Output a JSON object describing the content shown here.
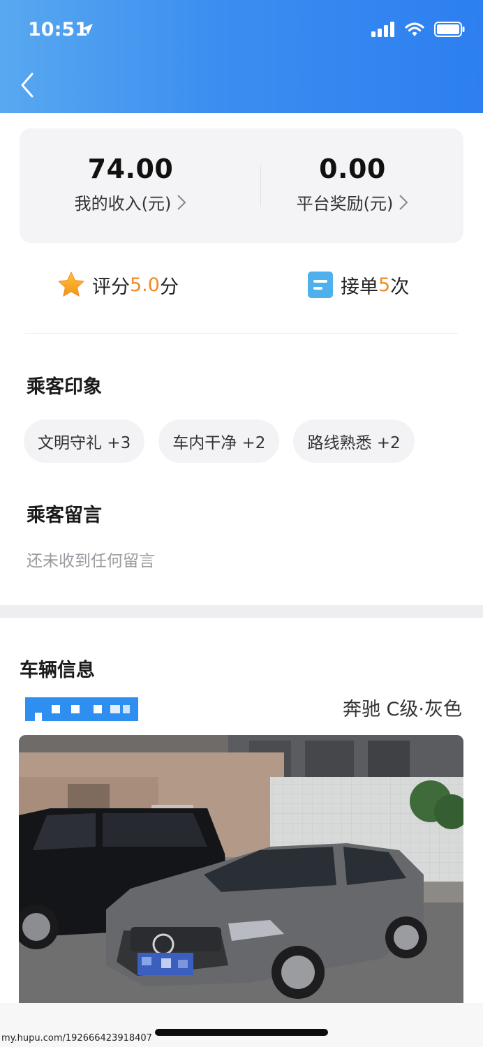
{
  "status_bar": {
    "time": "10:51"
  },
  "stats": {
    "income_value": "74.00",
    "income_label": "我的收入(元)",
    "reward_value": "0.00",
    "reward_label": "平台奖励(元)"
  },
  "metrics": {
    "rating_prefix": "评分",
    "rating_value": "5.0",
    "rating_suffix": "分",
    "orders_prefix": "接单",
    "orders_value": "5",
    "orders_suffix": "次"
  },
  "impressions": {
    "title": "乘客印象",
    "tags": [
      "文明守礼 +3",
      "车内干净 +2",
      "路线熟悉 +2"
    ]
  },
  "messages": {
    "title": "乘客留言",
    "empty_text": "还未收到任何留言"
  },
  "vehicle": {
    "title": "车辆信息",
    "model": "奔驰 C级·灰色"
  },
  "watermark": "my.hupu.com/192666423918407",
  "colors": {
    "header_gradient_start": "#58a8f0",
    "header_gradient_end": "#2d7ff0",
    "highlight_orange": "#f08a24",
    "card_bg": "#f4f4f6"
  },
  "icons": {
    "back": "chevron-left-icon",
    "rating": "star-icon",
    "orders": "document-icon"
  }
}
